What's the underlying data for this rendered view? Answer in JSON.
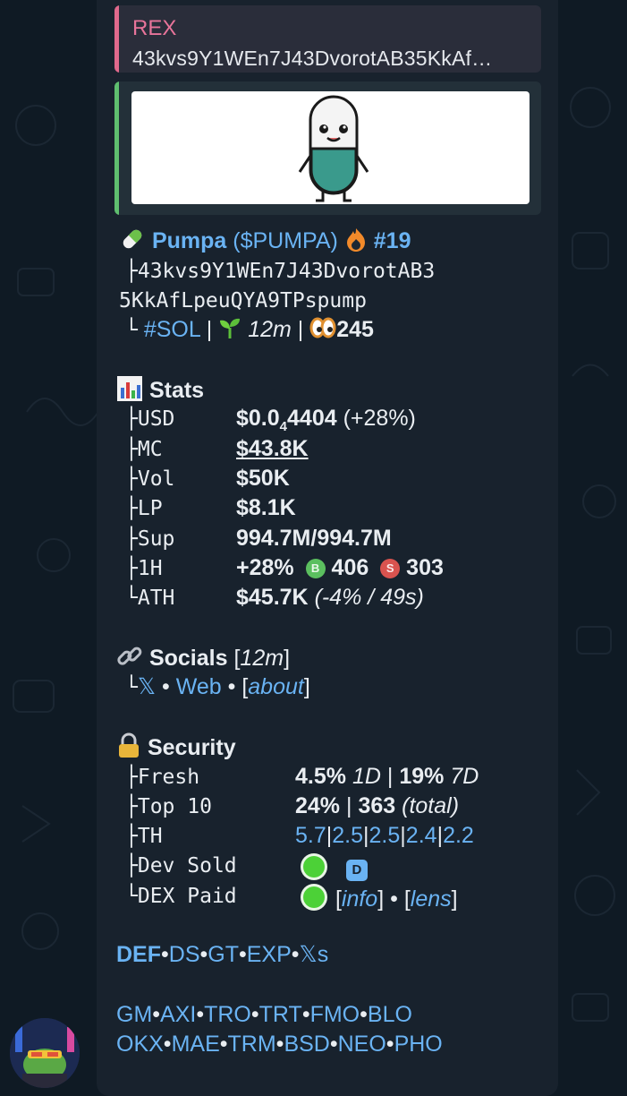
{
  "reply": {
    "name": "REX",
    "text": "43kvs9Y1WEn7J43DvorotAB35KkAf…"
  },
  "token": {
    "name": "Pumpa",
    "paren_open": "(",
    "ticker": "$PUMPA",
    "paren_close": ")",
    "rank": "#19",
    "ca_line1": "43kvs9Y1WEn7J43DvorotAB3",
    "ca_line2": "5KkAfLpeuQYA9TPspump",
    "chain": "#SOL",
    "age": "12m",
    "views": "245",
    "sep": "|"
  },
  "stats": {
    "title": "Stats",
    "usd_label": "USD",
    "usd_main": "$0.0",
    "usd_sub": "4",
    "usd_rest": "4404",
    "usd_change": "(+28%)",
    "mc_label": "MC",
    "mc_value": "$43.8K",
    "vol_label": "Vol",
    "vol_value": "$50K",
    "lp_label": "LP",
    "lp_value": "$8.1K",
    "sup_label": "Sup",
    "sup_value": "994.7M/994.7M",
    "h1_label": "1H",
    "h1_change": "+28%",
    "buy_badge": "B",
    "buys": "406",
    "sell_badge": "S",
    "sells": "303",
    "ath_label": "ATH",
    "ath_value": "$45.7K",
    "ath_detail": "(-4% / 49s)"
  },
  "socials": {
    "title": "Socials",
    "age_open": "[",
    "age": "12m",
    "age_close": "]",
    "x": "𝕏",
    "dot": "•",
    "web": "Web",
    "about_open": "[",
    "about": "about",
    "about_close": "]"
  },
  "security": {
    "title": "Security",
    "fresh_label": "Fresh",
    "fresh_1d": "4.5%",
    "fresh_1d_unit": "1D",
    "fresh_sep": "|",
    "fresh_7d": "19%",
    "fresh_7d_unit": "7D",
    "top10_label": "Top 10",
    "top10_pct": "24%",
    "top10_sep": "|",
    "top10_total": "363",
    "top10_total_label": "(total)",
    "th_label": "TH",
    "th_values": [
      "5.7",
      "2.5",
      "2.5",
      "2.4",
      "2.2"
    ],
    "th_sep": "|",
    "dev_label": "Dev Sold",
    "dev_badge": "D",
    "dex_label": "DEX Paid",
    "info_open": "[",
    "info": "info",
    "info_close": "]",
    "dot": "•",
    "lens_open": "[",
    "lens": "lens",
    "lens_close": "]"
  },
  "links_row1": [
    "DEF",
    "DS",
    "GT",
    "EXP",
    "𝕏s"
  ],
  "links_row2": [
    "GM",
    "AXI",
    "TRO",
    "TRT",
    "FMO",
    "BLO"
  ],
  "links_row3": [
    "OKX",
    "MAE",
    "TRM",
    "BSD",
    "NEO",
    "PHO"
  ],
  "link_sep": "•",
  "tree": {
    "branch": "├",
    "end": "└"
  },
  "colors": {
    "bg": "#0f1a24",
    "bubble": "#18222d",
    "link": "#6ab3f3",
    "reply_accent": "#e0698c",
    "preview_accent": "#5fbf6f",
    "buy": "#5bbf5f",
    "sell": "#d9534f",
    "check": "#4cd137"
  },
  "icons": [
    "pill-icon",
    "fire-icon",
    "seedling-icon",
    "eyes-icon",
    "chart-icon",
    "link-icon",
    "lock-icon",
    "buy-badge-icon",
    "sell-badge-icon",
    "check-circle-icon",
    "dev-badge-icon"
  ]
}
